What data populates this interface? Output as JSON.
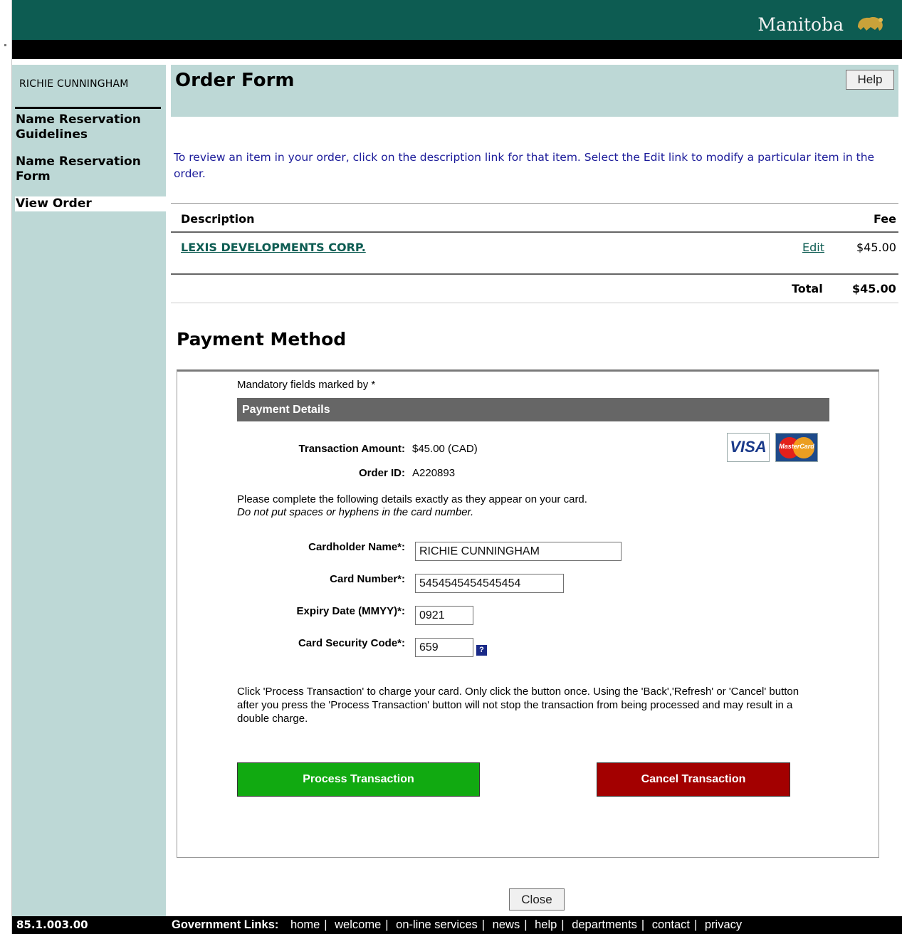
{
  "brand": {
    "name": "Manitoba"
  },
  "sidebar": {
    "user": "RICHIE CUNNINGHAM",
    "items": [
      {
        "label": "Name Reservation Guidelines"
      },
      {
        "label": "Name Reservation Form"
      },
      {
        "label": "View Order"
      }
    ]
  },
  "header": {
    "title": "Order Form",
    "help_label": "Help"
  },
  "instruction": "To review an item in your order, click on the description link for that item. Select the Edit link to modify a particular item in the order.",
  "order": {
    "columns": [
      "Description",
      "Fee"
    ],
    "items": [
      {
        "description": "LEXIS DEVELOPMENTS CORP.",
        "edit_label": "Edit",
        "fee": "$45.00"
      }
    ],
    "total_label": "Total",
    "total_value": "$45.00"
  },
  "payment": {
    "title": "Payment Method",
    "mandatory_note": "Mandatory fields marked by *",
    "details_header": "Payment Details",
    "amount_label": "Transaction Amount:",
    "amount_value": "$45.00 (CAD)",
    "order_id_label": "Order ID:",
    "order_id_value": "A220893",
    "instructions_line1": "Please complete the following details exactly as they appear on your card.",
    "instructions_line2": "Do not put spaces or hyphens in the card number.",
    "card_brands": {
      "visa": "VISA",
      "mastercard": "MasterCard"
    },
    "fields": {
      "cardholder_label": "Cardholder Name*:",
      "cardholder_value": "RICHIE CUNNINGHAM",
      "card_number_label": "Card Number*:",
      "card_number_value": "5454545454545454",
      "expiry_label": "Expiry Date (MMYY)*:",
      "expiry_value": "0921",
      "csc_label": "Card Security Code*:",
      "csc_value": "659"
    },
    "help_icon": "?",
    "warning": "Click 'Process Transaction' to charge your card. Only click the button once. Using the 'Back','Refresh' or 'Cancel' button after you press the 'Process Transaction' button will not stop the transaction from being processed and may result in a double charge.",
    "process_label": "Process Transaction",
    "cancel_label": "Cancel Transaction"
  },
  "close_label": "Close",
  "footer": {
    "version": "85.1.003.00",
    "gov_label": "Government Links:",
    "links": [
      "home",
      "welcome",
      "on-line services",
      "news",
      "help",
      "departments",
      "contact",
      "privacy"
    ]
  },
  "colors": {
    "topbar": "#0d5c52",
    "sidebar": "#bdd8d6",
    "process_button": "#11aa11",
    "cancel_button": "#a30000",
    "link": "#0d5c52",
    "instruction_text": "#1a1a99"
  }
}
